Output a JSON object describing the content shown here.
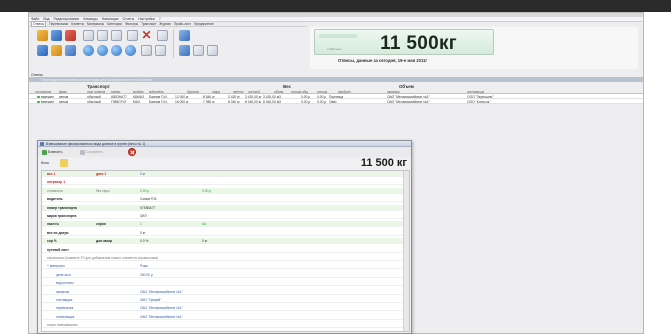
{
  "menu": [
    "Файл",
    "Вид",
    "Редактирование",
    "Команды",
    "Навигация",
    "Отчеты",
    "Настройки",
    "?"
  ],
  "tabs": [
    {
      "label": "Отвесы",
      "active": true
    },
    {
      "label": "Перевозчики"
    },
    {
      "label": "Клиенты"
    },
    {
      "label": "Материалы"
    },
    {
      "label": "Категории"
    },
    {
      "label": "Фильтры"
    },
    {
      "label": "Транспорт"
    },
    {
      "label": "Журнал"
    },
    {
      "label": "Прайс-лист"
    },
    {
      "label": "Предприятие"
    }
  ],
  "scale": {
    "weight": "11 500кг",
    "sublabel": "стабильно"
  },
  "report_caption": "Отвесы, данные за сегодня, 19-е мая 2011г",
  "otvesy_label": "Отвесы",
  "group_hint": "Перетащите заголовок колонки сюда для группировки по этой колонке",
  "grid": {
    "groups": {
      "transport": "Транспорт",
      "ves": "Вес",
      "obem": "Объем"
    },
    "columns": [
      "состояние",
      "флаг",
      "тип отвеса",
      "номер",
      "модель",
      "водитель",
      "брутто",
      "тара",
      "нетто",
      "чистый",
      "объем",
      "стоим.общ",
      "стоим.",
      "продукт",
      "заказчик",
      "поставщик"
    ],
    "rows": [
      {
        "status": "взвешен",
        "flag": "автом",
        "type": "обычный",
        "number": "А853НА77",
        "model": "КАМАЗ",
        "driver": "Баянов П.И.",
        "brutto": "12 000 кг",
        "tara": "8 840 кг",
        "netto": "3 420 кг",
        "chisty": "3 420,00 кг",
        "obem": "3 420,00 м3",
        "stoim_obsh": "0.00 р",
        "stoim": "0.00 р",
        "product": "Пшеница",
        "zakazchik": "ОАО \"Мельникомбинат №1\"",
        "postavshik": "ООО \"Зерношно\""
      },
      {
        "status": "взвешен",
        "flag": "автом",
        "type": "обычный",
        "number": "Г985СР47",
        "model": "МАЗ",
        "driver": "Баянов П.И.",
        "brutto": "16 000 кг",
        "tara": "7 980 кг",
        "netto": "8 040 кг",
        "chisty": "8 040,00 кг",
        "obem": "8 040,00 м3",
        "stoim_obsh": "0.00 р",
        "stoim": "0.00 р",
        "product": "Овёс",
        "zakazchik": "ОАО \"Мельникомбинат №1\"",
        "postavshik": "ООО \"Колосок\""
      }
    ]
  },
  "dialog": {
    "title": "Взвешивание фиксированного вида данные в группе [весы № 1]",
    "buttons": {
      "weigh": "Взвесить",
      "save": "Сохранить"
    },
    "scales_label": "Весы",
    "weight": "11 500 кг",
    "rows": [
      {
        "label": "вес 1",
        "label_style": "red",
        "label2": "дата 1",
        "label2_style": "red",
        "value": "0 кг",
        "value_style": "blue",
        "bg": "green"
      },
      {
        "label": "оператор 1",
        "label_style": "red",
        "bg": "plain"
      },
      {
        "label": "стоимость",
        "label_style": "muted",
        "label2": "без тары",
        "label2_style": "muted",
        "value": "0.00 р",
        "value_style": "green",
        "value2": "0.00 р",
        "value2_style": "green",
        "bg": "green"
      },
      {
        "label": "водитель",
        "label_style": "dark",
        "value": "Сомов П.В.",
        "value_style": "dark",
        "bg": "plain"
      },
      {
        "label": "номер транспорта",
        "label_style": "dark",
        "value": "К753ВА77",
        "value_style": "dark",
        "bg": "green"
      },
      {
        "label": "марка транспорта",
        "label_style": "dark",
        "value": "ЗИЛ",
        "value_style": "dark",
        "bg": "plain"
      },
      {
        "label": "накл №",
        "label_style": "dark",
        "label2": "серия",
        "label2_style": "dark",
        "value": "1",
        "value_style": "green",
        "value2": "АА",
        "value2_style": "green",
        "bg": "green"
      },
      {
        "label": "вес по докум",
        "label_style": "dark",
        "value": "0 кг",
        "value_style": "dark",
        "bg": "plain"
      },
      {
        "label": "сор %",
        "label_style": "dark",
        "label2": "доп.засор",
        "label2_style": "dark",
        "value": "0.0 %",
        "value_style": "dark",
        "value2": "0 кг",
        "value2_style": "dark",
        "bg": "green"
      },
      {
        "label": "путевой лист",
        "label_style": "dark",
        "bg": "plain"
      },
      {
        "label": "справочник (нажмите F2 для добавления нового элемента справочника)",
        "label_style": "muted",
        "bg": "plain"
      },
      {
        "label": "+ материал",
        "label_style": "blue",
        "value": "Рожь",
        "value_style": "blue",
        "bg": "plain"
      },
      {
        "label": "цена за кг",
        "label_style": "blue",
        "value": "250.00 р",
        "value_style": "blue",
        "bg": "plain",
        "indent": true
      },
      {
        "label": "вид оплаты",
        "label_style": "blue",
        "bg": "plain",
        "indent": true
      },
      {
        "label": "заказчик",
        "label_style": "blue",
        "value": "ОАО \"Мельникомбинат №1\"",
        "value_style": "blue",
        "bg": "plain",
        "indent": true
      },
      {
        "label": "поставщик",
        "label_style": "blue",
        "value": "ЗАО \"Урожай\"",
        "value_style": "blue",
        "bg": "plain",
        "indent": true
      },
      {
        "label": "перевозчик",
        "label_style": "blue",
        "value": "ОАО \"Мельникомбинат №1\"",
        "value_style": "blue",
        "bg": "plain",
        "indent": true
      },
      {
        "label": "плательщик",
        "label_style": "blue",
        "value": "ОАО \"Мельникомбинат №1\"",
        "value_style": "blue",
        "bg": "plain",
        "indent": true
      },
      {
        "label": "перил взвешивания",
        "label_style": "muted",
        "bg": "plain"
      }
    ]
  }
}
